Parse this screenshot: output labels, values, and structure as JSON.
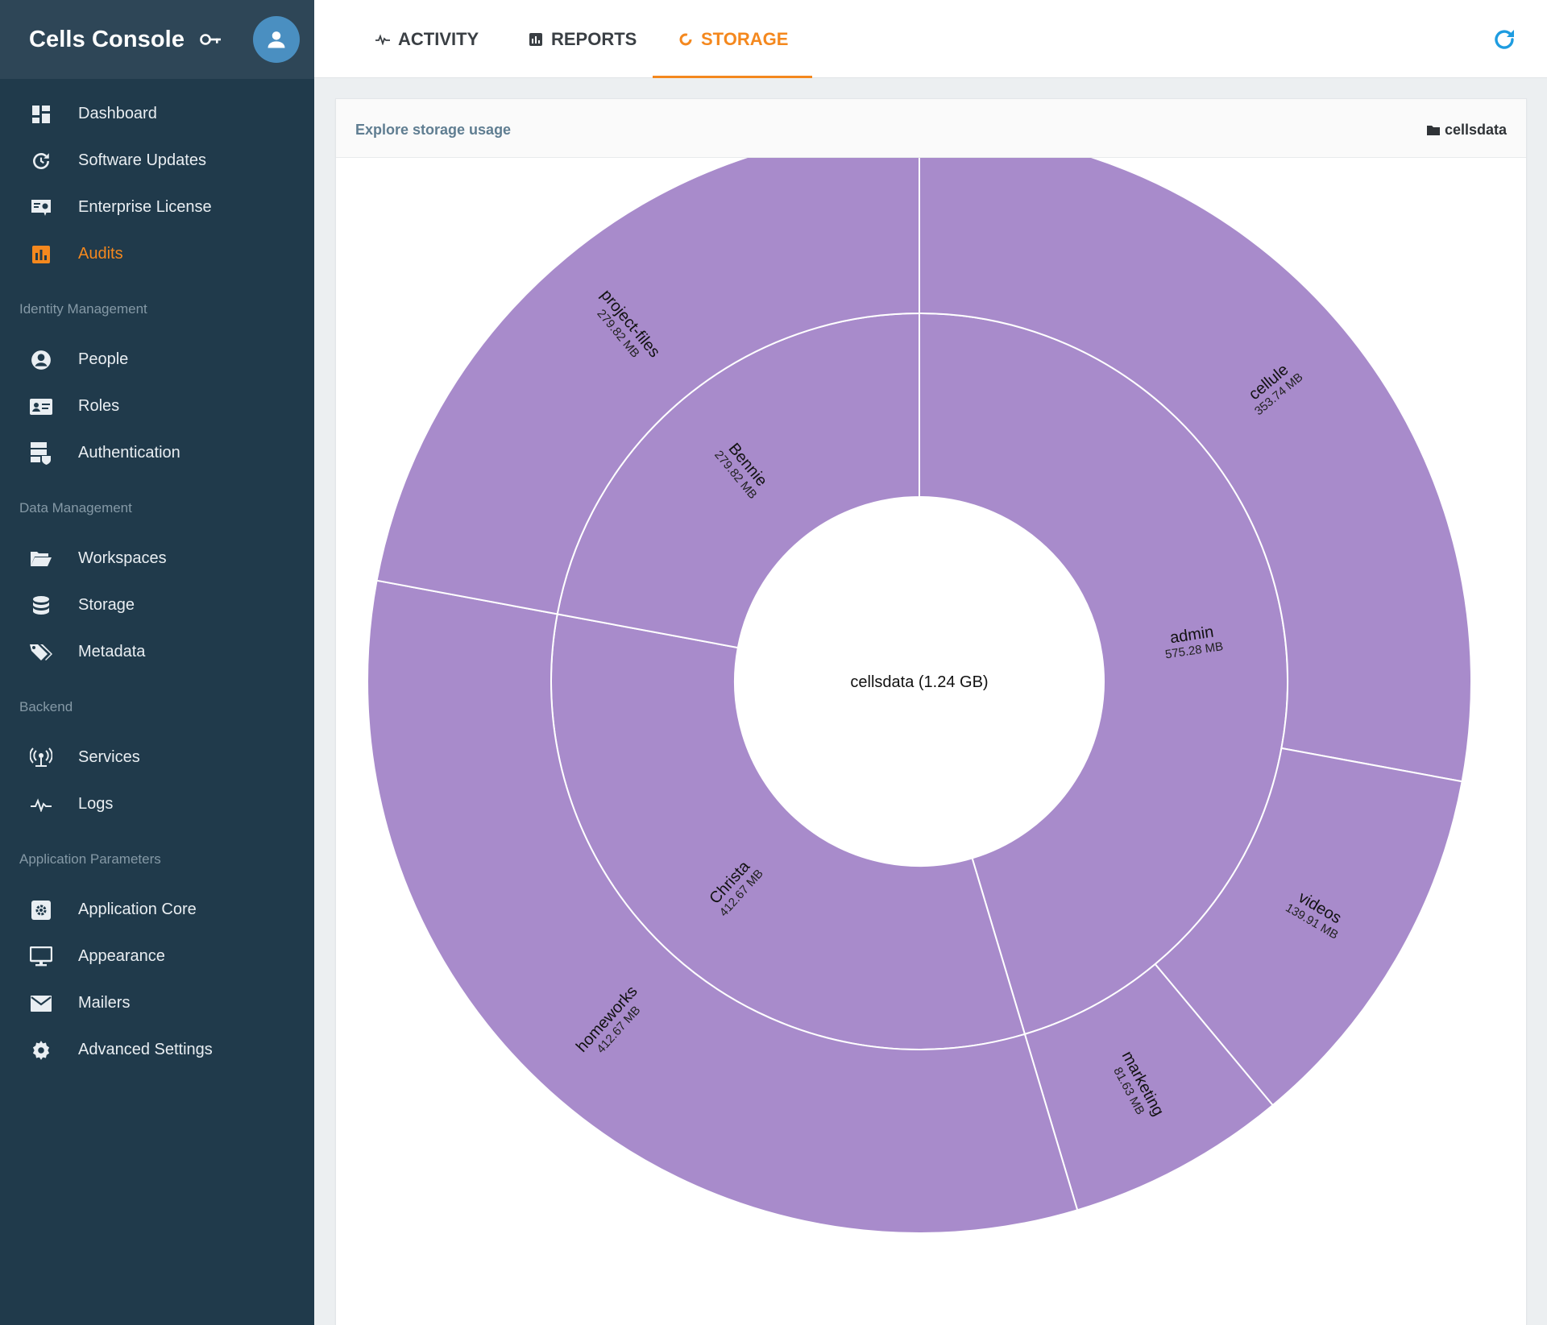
{
  "app": {
    "title": "Cells Console"
  },
  "sidebar": {
    "items": [
      {
        "label": "Dashboard",
        "icon": "dashboard-icon"
      },
      {
        "label": "Software Updates",
        "icon": "update-icon"
      },
      {
        "label": "Enterprise License",
        "icon": "certificate-icon"
      },
      {
        "label": "Audits",
        "icon": "chart-bar-icon",
        "active": true
      }
    ],
    "sections": [
      {
        "title": "Identity Management",
        "items": [
          {
            "label": "People",
            "icon": "user-circle-icon"
          },
          {
            "label": "Roles",
            "icon": "id-card-icon"
          },
          {
            "label": "Authentication",
            "icon": "server-security-icon"
          }
        ]
      },
      {
        "title": "Data Management",
        "items": [
          {
            "label": "Workspaces",
            "icon": "folder-open-icon"
          },
          {
            "label": "Storage",
            "icon": "database-icon"
          },
          {
            "label": "Metadata",
            "icon": "tags-icon"
          }
        ]
      },
      {
        "title": "Backend",
        "items": [
          {
            "label": "Services",
            "icon": "antenna-icon"
          },
          {
            "label": "Logs",
            "icon": "pulse-icon"
          }
        ]
      },
      {
        "title": "Application Parameters",
        "items": [
          {
            "label": "Application Core",
            "icon": "gear-box-icon"
          },
          {
            "label": "Appearance",
            "icon": "monitor-icon"
          },
          {
            "label": "Mailers",
            "icon": "envelope-icon"
          },
          {
            "label": "Advanced Settings",
            "icon": "gear-icon"
          }
        ]
      }
    ]
  },
  "tabs": [
    {
      "label": "ACTIVITY",
      "icon": "pulse-icon"
    },
    {
      "label": "REPORTS",
      "icon": "report-icon"
    },
    {
      "label": "STORAGE",
      "icon": "pie-icon",
      "active": true
    }
  ],
  "card": {
    "title": "Explore storage usage",
    "path": "cellsdata"
  },
  "colors": {
    "sidebar": "#203a4b",
    "accent": "#f4881e",
    "segment": "#a88bcb",
    "refresh": "#1e9ce0"
  },
  "chart_data": {
    "type": "sunburst",
    "root": {
      "name": "cellsdata",
      "label": "cellsdata (1.24 GB)",
      "size_mb": 1268
    },
    "children": [
      {
        "name": "admin",
        "size_label": "575.28 MB",
        "size_mb": 575.28,
        "children": [
          {
            "name": "cellule",
            "size_label": "353.74 MB",
            "size_mb": 353.74
          },
          {
            "name": "videos",
            "size_label": "139.91 MB",
            "size_mb": 139.91
          },
          {
            "name": "marketing",
            "size_label": "81.63 MB",
            "size_mb": 81.63
          }
        ]
      },
      {
        "name": "Christa",
        "size_label": "412.67 MB",
        "size_mb": 412.67,
        "children": [
          {
            "name": "homeworks",
            "size_label": "412.67 MB",
            "size_mb": 412.67
          }
        ]
      },
      {
        "name": "Bennie",
        "size_label": "279.82 MB",
        "size_mb": 279.82,
        "children": [
          {
            "name": "project-files",
            "size_label": "279.82 MB",
            "size_mb": 279.82
          }
        ]
      }
    ]
  }
}
